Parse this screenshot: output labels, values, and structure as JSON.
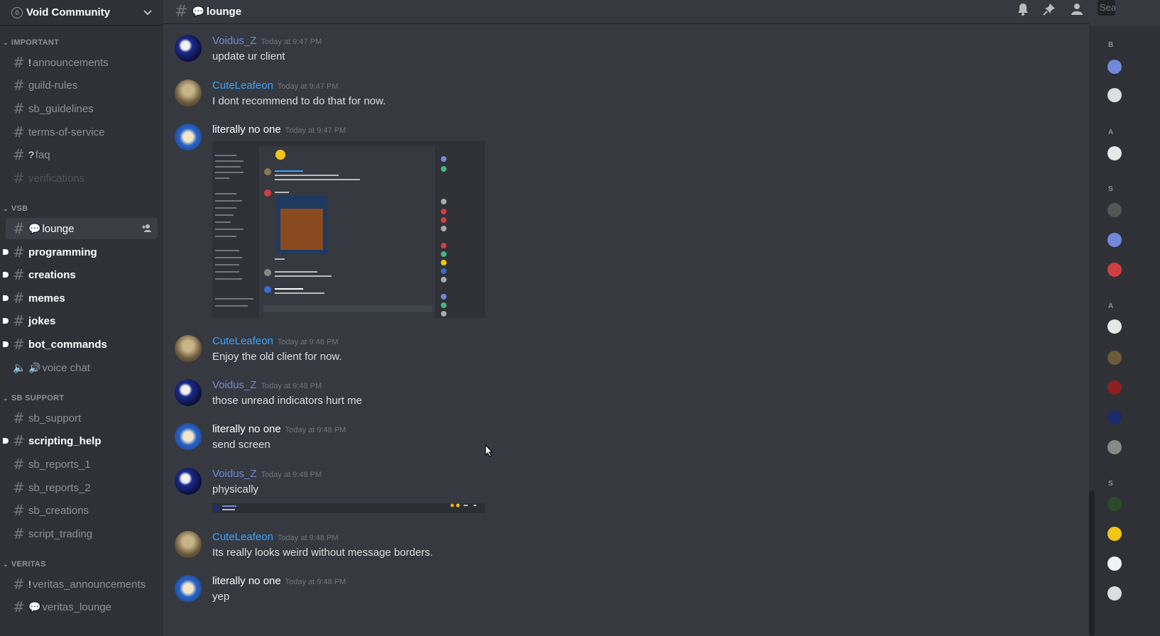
{
  "guild": {
    "name": "Void Community",
    "icon": "0"
  },
  "sidebar": {
    "categories": [
      {
        "label": "IMPORTANT"
      },
      {
        "label": "VSB"
      },
      {
        "label": "SB SUPPORT"
      },
      {
        "label": "VERITAS"
      }
    ],
    "channels": [
      {
        "label": "announcements",
        "prefix": "!"
      },
      {
        "label": "guild-rules"
      },
      {
        "label": "sb_guidelines"
      },
      {
        "label": "terms-of-service"
      },
      {
        "label": "faq",
        "prefix": "?"
      },
      {
        "label": "verifications"
      },
      {
        "label": "lounge",
        "prefix": "💬"
      },
      {
        "label": "programming"
      },
      {
        "label": "creations"
      },
      {
        "label": "memes"
      },
      {
        "label": "jokes"
      },
      {
        "label": "bot_commands"
      },
      {
        "label": "voice chat",
        "prefix": "🔊"
      },
      {
        "label": "sb_support"
      },
      {
        "label": "scripting_help"
      },
      {
        "label": "sb_reports_1"
      },
      {
        "label": "sb_reports_2"
      },
      {
        "label": "sb_creations"
      },
      {
        "label": "script_trading"
      },
      {
        "label": "veritas_announcements",
        "prefix": "!"
      },
      {
        "label": "veritas_lounge",
        "prefix": "💬"
      }
    ]
  },
  "header": {
    "channel": "lounge",
    "channel_icon": "💬",
    "search_placeholder": "Sea"
  },
  "messages": [
    {
      "author": "Voidus_Z",
      "time": "Today at 9:47 PM",
      "text": "update ur client"
    },
    {
      "author": "CuteLeafeon",
      "time": "Today at 9:47 PM",
      "text": "I dont recommend to do that for now."
    },
    {
      "author": "literally no one",
      "time": "Today at 9:47 PM",
      "text": ""
    },
    {
      "author": "CuteLeafeon",
      "time": "Today at 9:48 PM",
      "text": "Enjoy the old client for now."
    },
    {
      "author": "Voidus_Z",
      "time": "Today at 9:48 PM",
      "text": "those unread indicators hurt me"
    },
    {
      "author": "literally no one",
      "time": "Today at 9:48 PM",
      "text": "send screen"
    },
    {
      "author": "Voidus_Z",
      "time": "Today at 9:48 PM",
      "text": "physically"
    },
    {
      "author": "CuteLeafeon",
      "time": "Today at 9:48 PM",
      "text": "Its really looks weird without message borders."
    },
    {
      "author": "literally no one",
      "time": "Today at 9:48 PM",
      "text": "yep"
    }
  ],
  "icons": {
    "bell": "bell-icon",
    "pin": "pin-icon",
    "members": "members-icon",
    "add_member": "add-member-icon",
    "chevron": "chevron-down-icon",
    "speaker": "speaker-icon"
  },
  "colors": {
    "voidus": "#7289da",
    "cute": "#3ca4ff",
    "lno": "#ffffff",
    "background": "#36393f",
    "sidebar": "#2f3136"
  },
  "members_panel": {
    "letters": [
      "B",
      "A",
      "S",
      "A",
      "S"
    ]
  }
}
